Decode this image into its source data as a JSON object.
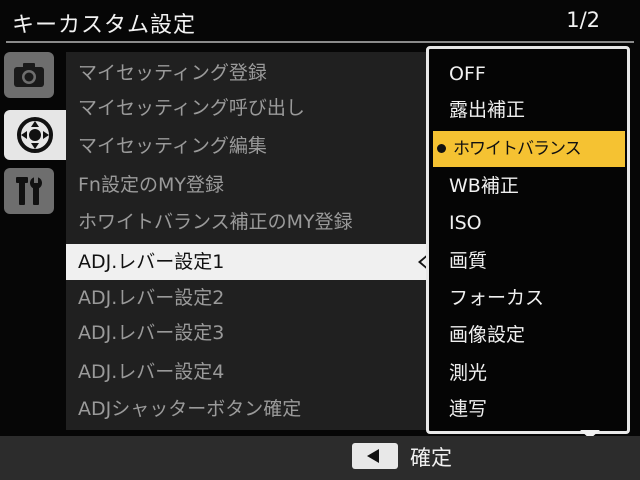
{
  "header": {
    "title": "キーカスタム設定",
    "page": "1/2"
  },
  "tabs": [
    {
      "name": "camera",
      "icon": "camera-icon",
      "active": false
    },
    {
      "name": "setup",
      "icon": "dial-icon",
      "active": true
    },
    {
      "name": "tools",
      "icon": "wrench-icon",
      "active": false
    }
  ],
  "menu": {
    "items": [
      {
        "label": "マイセッティング登録"
      },
      {
        "label": "マイセッティング呼び出し"
      },
      {
        "label": "マイセッティング編集"
      },
      {
        "label": "Fn設定のMY登録"
      },
      {
        "label": "ホワイトバランス補正のMY登録"
      },
      {
        "label": "ADJ.レバー設定1",
        "selected": true
      },
      {
        "label": "ADJ.レバー設定2"
      },
      {
        "label": "ADJ.レバー設定3"
      },
      {
        "label": "ADJ.レバー設定4"
      },
      {
        "label": "ADJシャッターボタン確定"
      }
    ]
  },
  "dropdown": {
    "options": [
      {
        "label": "OFF"
      },
      {
        "label": "露出補正"
      },
      {
        "label": "ホワイトバランス",
        "selected": true
      },
      {
        "label": "WB補正"
      },
      {
        "label": "ISO"
      },
      {
        "label": "画質"
      },
      {
        "label": "フォーカス"
      },
      {
        "label": "画像設定"
      },
      {
        "label": "測光"
      },
      {
        "label": "連写"
      }
    ],
    "highlight_color": "#f5c232"
  },
  "footer": {
    "key_icon": "left-arrow-key-icon",
    "label": "確定"
  }
}
